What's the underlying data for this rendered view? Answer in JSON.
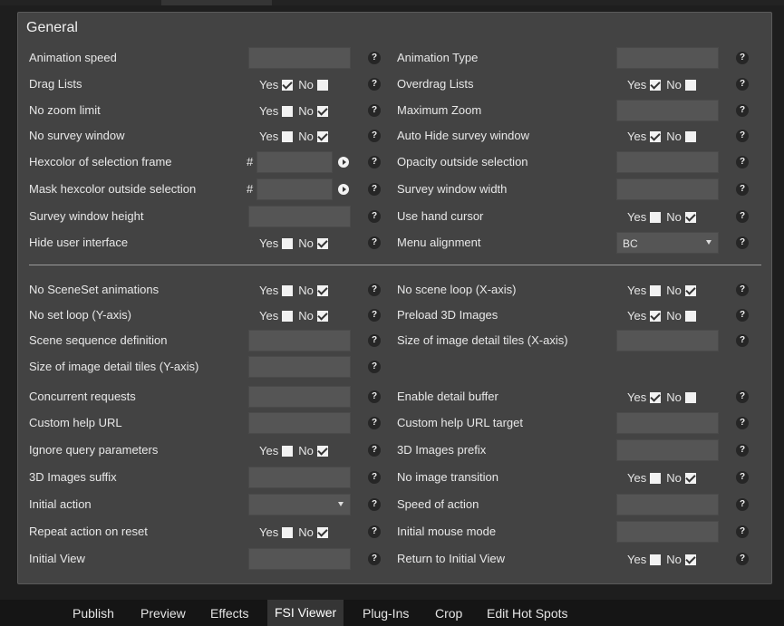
{
  "panel": {
    "title": "General"
  },
  "yes": "Yes",
  "no": "No",
  "help": "?",
  "hash": "#",
  "rows": [
    {
      "left": {
        "label": "Animation speed"
      },
      "right": {
        "label": "Animation Type"
      }
    },
    {
      "left": {
        "label": "Drag Lists",
        "yes_checked": true
      },
      "right": {
        "label": "Overdrag Lists",
        "yes_checked": true
      }
    },
    {
      "left": {
        "label": "No zoom limit",
        "yes_checked": false
      },
      "right": {
        "label": "Maximum Zoom"
      }
    },
    {
      "left": {
        "label": "No survey window",
        "yes_checked": false
      },
      "right": {
        "label": "Auto Hide survey window",
        "yes_checked": true
      }
    },
    {
      "left": {
        "label": "Hexcolor of selection frame"
      },
      "right": {
        "label": "Opacity outside selection"
      }
    },
    {
      "left": {
        "label": "Mask hexcolor outside selection"
      },
      "right": {
        "label": "Survey window width"
      }
    },
    {
      "left": {
        "label": "Survey window height"
      },
      "right": {
        "label": "Use hand cursor",
        "yes_checked": false
      }
    },
    {
      "left": {
        "label": "Hide user interface",
        "yes_checked": false
      },
      "right": {
        "label": "Menu alignment",
        "value": "BC"
      }
    },
    {
      "left": {
        "label": "No SceneSet animations",
        "yes_checked": false
      },
      "right": {
        "label": "No scene loop (X-axis)",
        "yes_checked": false
      }
    },
    {
      "left": {
        "label": "No set loop (Y-axis)",
        "yes_checked": false
      },
      "right": {
        "label": "Preload 3D Images",
        "yes_checked": true
      }
    },
    {
      "left": {
        "label": "Scene sequence definition"
      },
      "right": {
        "label": "Size of image detail tiles (X-axis)"
      }
    },
    {
      "left": {
        "label": "Size of image detail tiles (Y-axis)"
      }
    },
    {
      "left": {
        "label": "Concurrent requests"
      },
      "right": {
        "label": "Enable detail buffer",
        "yes_checked": true
      }
    },
    {
      "left": {
        "label": "Custom help URL"
      },
      "right": {
        "label": "Custom help URL target"
      }
    },
    {
      "left": {
        "label": "Ignore query parameters",
        "yes_checked": false
      },
      "right": {
        "label": "3D Images prefix"
      }
    },
    {
      "left": {
        "label": "3D Images suffix"
      },
      "right": {
        "label": "No image transition",
        "yes_checked": false
      }
    },
    {
      "left": {
        "label": "Initial action",
        "value": ""
      },
      "right": {
        "label": "Speed of action"
      }
    },
    {
      "left": {
        "label": "Repeat action on reset",
        "yes_checked": false
      },
      "right": {
        "label": "Initial mouse mode"
      }
    },
    {
      "left": {
        "label": "Initial View"
      },
      "right": {
        "label": "Return to Initial View",
        "yes_checked": false
      }
    }
  ],
  "tabs": [
    "Publish",
    "Preview",
    "Effects",
    "FSI Viewer",
    "Plug-Ins",
    "Crop",
    "Edit Hot Spots"
  ],
  "active_tab": "FSI Viewer"
}
